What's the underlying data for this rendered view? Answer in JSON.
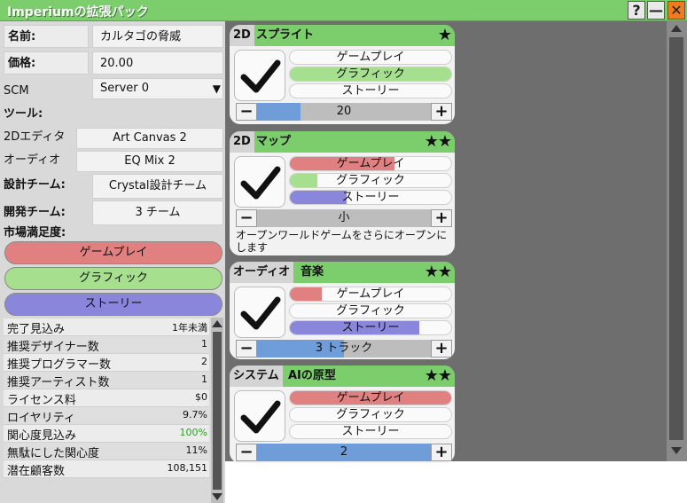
{
  "window": {
    "title": "Imperiumの拡張パック",
    "help": "?",
    "minimize": "—",
    "close": "✕"
  },
  "colors": {
    "gameplay": "#e08080",
    "graphics": "#a6e08f",
    "story": "#8a86dc",
    "header": "#7ccd6c",
    "progress": "#6e9dd9"
  },
  "form": {
    "name_label": "名前:",
    "name_value": "カルタゴの脅威",
    "price_label": "価格:",
    "price_value": "20.00",
    "scm_label": "SCM",
    "scm_value": "Server 0",
    "tools_label": "ツール:",
    "editor_label": "2Dエディタ",
    "editor_value": "Art Canvas 2",
    "audio_label": "オーディオ",
    "audio_value": "EQ Mix 2",
    "design_team_label": "設計チーム:",
    "design_team_value": "Crystal設計チーム",
    "dev_team_label": "開発チーム:",
    "dev_team_value": "3 チーム",
    "market_label": "市場満足度:",
    "market_gameplay": "ゲームプレイ",
    "market_graphics": "グラフィック",
    "market_story": "ストーリー"
  },
  "stats": [
    {
      "label": "完了見込み",
      "value": "1年未満"
    },
    {
      "label": "推奨デザイナー数",
      "value": "1"
    },
    {
      "label": "推奨プログラマー数",
      "value": "2"
    },
    {
      "label": "推奨アーティスト数",
      "value": "1"
    },
    {
      "label": "ライセンス料",
      "value": "$0"
    },
    {
      "label": "ロイヤリティ",
      "value": "9.7%"
    },
    {
      "label": "関心度見込み",
      "value": "100%"
    },
    {
      "label": "無駄にした関心度",
      "value": "11%"
    },
    {
      "label": "潜在顧客数",
      "value": "108,151"
    }
  ],
  "cards": [
    {
      "tag": "2D",
      "name": "スプライト",
      "stars": "★",
      "pills": [
        {
          "label": "ゲームプレイ",
          "fill": 0
        },
        {
          "label": "グラフィック",
          "fill": 1.0
        },
        {
          "label": "ストーリー",
          "fill": 0
        }
      ],
      "stepper_value": "20",
      "stepper_fill": 0.25
    },
    {
      "tag": "2D",
      "name": "マップ",
      "stars": "★★",
      "pills": [
        {
          "label": "ゲームプレイ",
          "fill": 0.65
        },
        {
          "label": "グラフィック",
          "fill": 0.17
        },
        {
          "label": "ストーリー",
          "fill": 0.35
        }
      ],
      "stepper_value": "小",
      "stepper_fill": 0,
      "description": "オープンワールドゲームをさらにオープンにします"
    },
    {
      "tag": "オーディオ",
      "name": "音楽",
      "stars": "★★",
      "pills": [
        {
          "label": "ゲームプレイ",
          "fill": 0.2
        },
        {
          "label": "グラフィック",
          "fill": 0
        },
        {
          "label": "ストーリー",
          "fill": 0.8
        }
      ],
      "stepper_value": "3 トラック",
      "stepper_fill": 0.5
    },
    {
      "tag": "システム",
      "name": "AIの原型",
      "stars": "★★",
      "pills": [
        {
          "label": "ゲームプレイ",
          "fill": 1.0
        },
        {
          "label": "グラフィック",
          "fill": 0
        },
        {
          "label": "ストーリー",
          "fill": 0
        }
      ],
      "stepper_value": "2",
      "stepper_fill": 1.0
    }
  ]
}
